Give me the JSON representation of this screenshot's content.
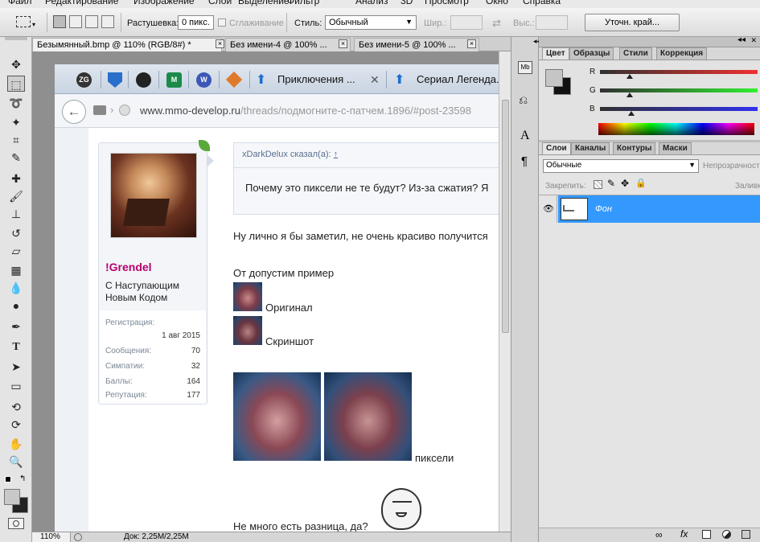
{
  "menu": [
    "Файл",
    "Редактирование",
    "Изображение",
    "Слои",
    "Выделение",
    "Фильтр",
    "Анализ",
    "3D",
    "Просмотр",
    "Окно",
    "Справка"
  ],
  "options": {
    "feather_label": "Растушевка:",
    "feather_value": "0 пикс.",
    "antialias_label": "Сглаживание",
    "style_label": "Стиль:",
    "style_value": "Обычный",
    "width_label": "Шир.:",
    "height_label": "Выс.:",
    "refine_button": "Уточн. край..."
  },
  "doc_tabs": [
    {
      "label": "Безымянный.bmp @ 110% (RGB/8#) *"
    },
    {
      "label": "Без имени-4 @ 100% ..."
    },
    {
      "label": "Без имени-5 @ 100% ..."
    }
  ],
  "status": {
    "zoom": "110%",
    "doc": "Док: 2,25M/2,25M"
  },
  "browser": {
    "icons": [
      "ZG",
      "",
      "",
      "M",
      "W",
      ""
    ],
    "tab1": "Приключения ...",
    "tab2": "Сериал Легенда...",
    "url_domain": "www.mmo-develop.ru",
    "url_path": "/threads/подмогните-с-патчем.1896/#post-23598"
  },
  "user": {
    "name": "!Grendel",
    "title": "С Наступающим Новым Кодом",
    "stats": [
      {
        "label": "Регистрация:",
        "value": ""
      },
      {
        "label": "",
        "value": "1 авг 2015"
      },
      {
        "label": "Сообщения:",
        "value": "70"
      },
      {
        "label": "Симпатии:",
        "value": "32"
      },
      {
        "label": "Баллы:",
        "value": "164"
      },
      {
        "label": "Репутация:",
        "value": "177"
      }
    ]
  },
  "post": {
    "quote_author": "xDarkDelux сказал(а):",
    "quote_arrow": "↑",
    "quote_text": "Почему это пиксели не те будут? Из-за сжатия? Я",
    "line1": "Ну лично я бы заметил, не очень красиво получится",
    "line2": "От допустим пример",
    "label_original": "Оригинал",
    "label_screenshot": "Скриншот",
    "label_pixels": "пиксели",
    "line3": "Не много есть разница, да?"
  },
  "color_panel": {
    "tabs": [
      "Цвет",
      "Образцы",
      "Стили",
      "Коррекция"
    ],
    "channels": [
      {
        "name": "R",
        "value": 0.19
      },
      {
        "name": "G",
        "value": 0.19
      },
      {
        "name": "B",
        "value": 0.2
      }
    ]
  },
  "layers_panel": {
    "tabs": [
      "Слои",
      "Каналы",
      "Контуры",
      "Маски"
    ],
    "blend_mode": "Обычные",
    "opacity_label": "Непрозрачность:",
    "lock_label": "Закрепить:",
    "fill_label": "Заливка:",
    "layer_name": "Фон"
  },
  "colors": {
    "accent": "#3399ff",
    "forum_name": "#b8006e"
  }
}
